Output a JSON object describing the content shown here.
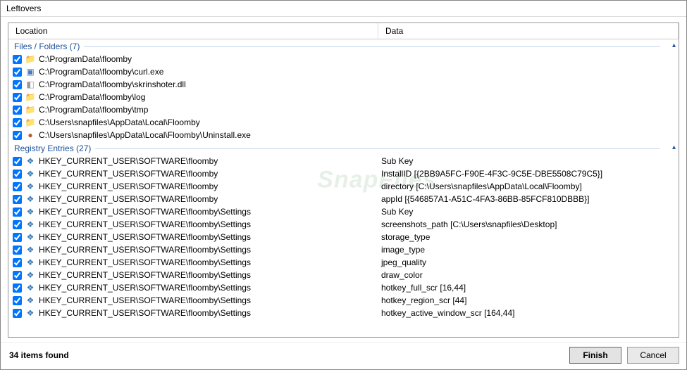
{
  "window": {
    "title": "Leftovers"
  },
  "columns": {
    "location": "Location",
    "data": "Data"
  },
  "groups": {
    "files": {
      "label": "Files / Folders (7)"
    },
    "registry": {
      "label": "Registry Entries (27)"
    }
  },
  "files": [
    {
      "icon": "folder",
      "path": "C:\\ProgramData\\floomby",
      "data": ""
    },
    {
      "icon": "exe",
      "path": "C:\\ProgramData\\floomby\\curl.exe",
      "data": ""
    },
    {
      "icon": "dll",
      "path": "C:\\ProgramData\\floomby\\skrinshoter.dll",
      "data": ""
    },
    {
      "icon": "folder",
      "path": "C:\\ProgramData\\floomby\\log",
      "data": ""
    },
    {
      "icon": "folder",
      "path": "C:\\ProgramData\\floomby\\tmp",
      "data": ""
    },
    {
      "icon": "folder",
      "path": "C:\\Users\\snapfiles\\AppData\\Local\\Floomby",
      "data": ""
    },
    {
      "icon": "uninst",
      "path": "C:\\Users\\snapfiles\\AppData\\Local\\Floomby\\Uninstall.exe",
      "data": ""
    }
  ],
  "registry": [
    {
      "path": "HKEY_CURRENT_USER\\SOFTWARE\\floomby",
      "data": "Sub Key"
    },
    {
      "path": "HKEY_CURRENT_USER\\SOFTWARE\\floomby",
      "data": "InstallID [{2BB9A5FC-F90E-4F3C-9C5E-DBE5508C79C5}]"
    },
    {
      "path": "HKEY_CURRENT_USER\\SOFTWARE\\floomby",
      "data": "directory [C:\\Users\\snapfiles\\AppData\\Local\\Floomby]"
    },
    {
      "path": "HKEY_CURRENT_USER\\SOFTWARE\\floomby",
      "data": "appId [{546857A1-A51C-4FA3-86BB-85FCF810DBBB}]"
    },
    {
      "path": "HKEY_CURRENT_USER\\SOFTWARE\\floomby\\Settings",
      "data": "Sub Key"
    },
    {
      "path": "HKEY_CURRENT_USER\\SOFTWARE\\floomby\\Settings",
      "data": "screenshots_path [C:\\Users\\snapfiles\\Desktop]"
    },
    {
      "path": "HKEY_CURRENT_USER\\SOFTWARE\\floomby\\Settings",
      "data": "storage_type"
    },
    {
      "path": "HKEY_CURRENT_USER\\SOFTWARE\\floomby\\Settings",
      "data": "image_type"
    },
    {
      "path": "HKEY_CURRENT_USER\\SOFTWARE\\floomby\\Settings",
      "data": "jpeg_quality"
    },
    {
      "path": "HKEY_CURRENT_USER\\SOFTWARE\\floomby\\Settings",
      "data": "draw_color"
    },
    {
      "path": "HKEY_CURRENT_USER\\SOFTWARE\\floomby\\Settings",
      "data": "hotkey_full_scr [16,44]"
    },
    {
      "path": "HKEY_CURRENT_USER\\SOFTWARE\\floomby\\Settings",
      "data": "hotkey_region_scr [44]"
    },
    {
      "path": "HKEY_CURRENT_USER\\SOFTWARE\\floomby\\Settings",
      "data": "hotkey_active_window_scr [164,44]"
    }
  ],
  "footer": {
    "status": "34 items found",
    "finish": "Finish",
    "cancel": "Cancel"
  },
  "watermark": "SnapFiles"
}
